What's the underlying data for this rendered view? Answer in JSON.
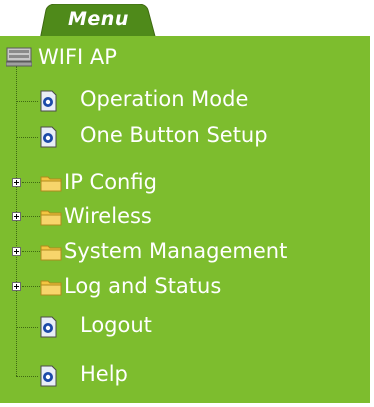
{
  "menu": {
    "tab_label": "Menu",
    "root": {
      "label": "WIFI AP",
      "icon": "monitor-icon"
    },
    "items": [
      {
        "label": "Operation Mode",
        "icon": "document-icon",
        "expandable": false
      },
      {
        "label": "One Button Setup",
        "icon": "document-icon",
        "expandable": false
      },
      {
        "label": "IP Config",
        "icon": "folder-icon",
        "expandable": true
      },
      {
        "label": "Wireless",
        "icon": "folder-icon",
        "expandable": true
      },
      {
        "label": "System Management",
        "icon": "folder-icon",
        "expandable": true
      },
      {
        "label": "Log and Status",
        "icon": "folder-icon",
        "expandable": true
      },
      {
        "label": "Logout",
        "icon": "document-icon",
        "expandable": false
      },
      {
        "label": "Help",
        "icon": "document-icon",
        "expandable": false
      }
    ]
  },
  "colors": {
    "panel_background": "#7dbd2e",
    "tab_background": "#4f8a1a",
    "text": "#ffffff"
  }
}
